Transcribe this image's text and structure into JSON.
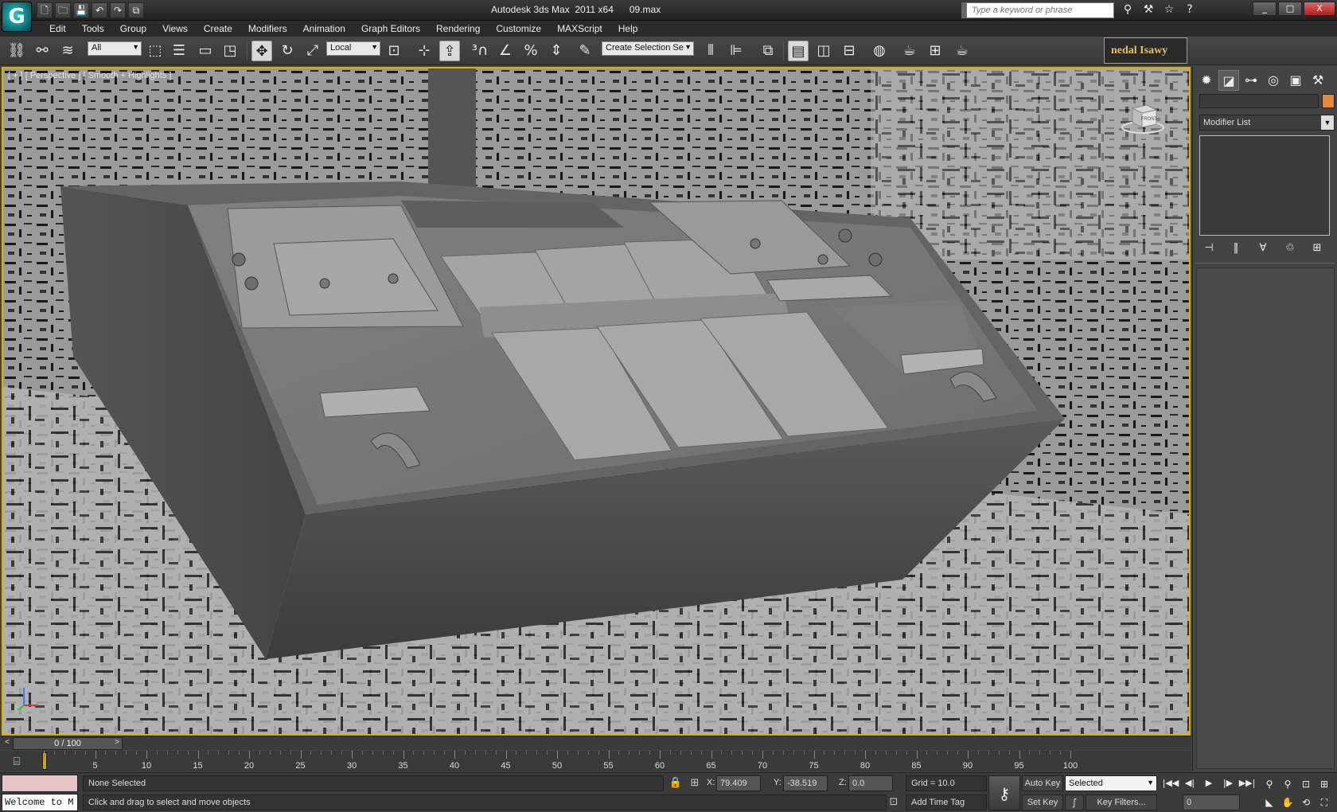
{
  "app": {
    "logo_glyph": "G",
    "title": "Autodesk 3ds Max  2011 x64      09.max"
  },
  "quick_access": [
    "🗋",
    "🗀",
    "💾",
    "↶",
    "↷",
    "⧉"
  ],
  "search": {
    "placeholder": "Type a keyword or phrase"
  },
  "title_tools": [
    "⚲",
    "⚒",
    "☆",
    "?"
  ],
  "window_controls": {
    "minimize": "_",
    "maximize": "□",
    "close": "X"
  },
  "menu": {
    "items": [
      "Edit",
      "Tools",
      "Group",
      "Views",
      "Create",
      "Modifiers",
      "Animation",
      "Graph Editors",
      "Rendering",
      "Customize",
      "MAXScript",
      "Help"
    ]
  },
  "toolbar": {
    "selection_filter": "All",
    "reference_coord": "Local",
    "named_selection": "Create Selection Se",
    "user_badge": "nedal Isawy"
  },
  "viewport": {
    "label": "[ + ] [ Perspective ] [ Smooth + Highlights ]",
    "viewcube_label": "FRONT",
    "axis_x": "x",
    "axis_y": "y",
    "axis_z": "z"
  },
  "command_panel": {
    "modifier_list": "Modifier List",
    "object_color": "#e8873f"
  },
  "time_slider": {
    "position": "0 / 100",
    "prev": "<",
    "next": ">"
  },
  "trackbar": {
    "ticks": [
      0,
      5,
      10,
      15,
      20,
      25,
      30,
      35,
      40,
      45,
      50,
      55,
      60,
      65,
      70,
      75,
      80,
      85,
      90,
      95,
      100
    ],
    "current_frame": 0
  },
  "status": {
    "listener_text": "Welcome to M",
    "selection": "None Selected",
    "prompt": "Click and drag to select and move objects",
    "x_label": "X:",
    "x_value": "79.409",
    "y_label": "Y:",
    "y_value": "-38.519",
    "z_label": "Z:",
    "z_value": "0.0",
    "grid": "Grid = 10.0",
    "add_time_tag": "Add Time Tag",
    "auto_key": "Auto Key",
    "set_key": "Set Key",
    "key_mode": "Selected",
    "key_filters": "Key Filters...",
    "frame_value": "0"
  },
  "colors": {
    "active_viewport_border": "#d8b400",
    "ui_background": "#444444"
  }
}
